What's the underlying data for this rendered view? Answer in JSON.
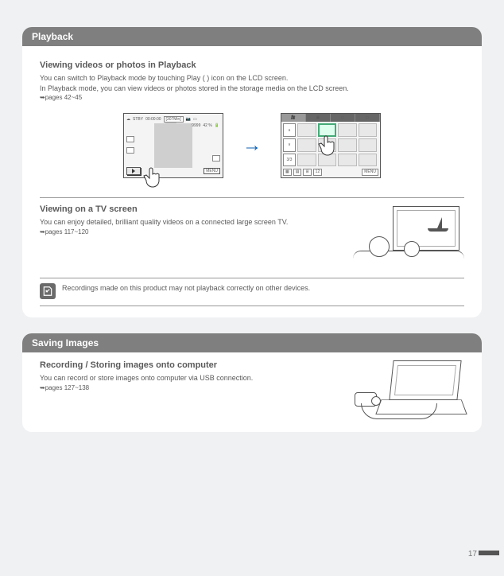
{
  "page_number": "17",
  "section_playback": {
    "header": "Playback",
    "sub_view": {
      "title": "Viewing videos or photos in Playback",
      "body1": "You can switch to Playback mode by touching Play (    ) icon on the LCD screen.",
      "body2": "In Playback mode, you can view videos or photos stored in the storage media on the LCD screen.",
      "ref": "➥pages 42~45",
      "lcd_shoot": {
        "mode": "STBY",
        "time": "00:00:00",
        "remain": "[307Min]",
        "counter": "9999",
        "battery": "42 %",
        "menu": "MENU"
      },
      "lcd_thumb": {
        "pager": "3/3",
        "count": "12",
        "menu": "MENU"
      }
    },
    "sub_tv": {
      "title": "Viewing on a TV screen",
      "body": "You can enjoy detailed, brilliant quality videos on a connected large screen TV.",
      "ref": "➥pages 117~120"
    },
    "note": "Recordings made on this product may not playback correctly on other devices."
  },
  "section_save": {
    "header": "Saving Images",
    "title": "Recording / Storing images onto computer",
    "body": "You can record or store images onto computer via USB connection.",
    "ref": "➥pages 127~138"
  }
}
